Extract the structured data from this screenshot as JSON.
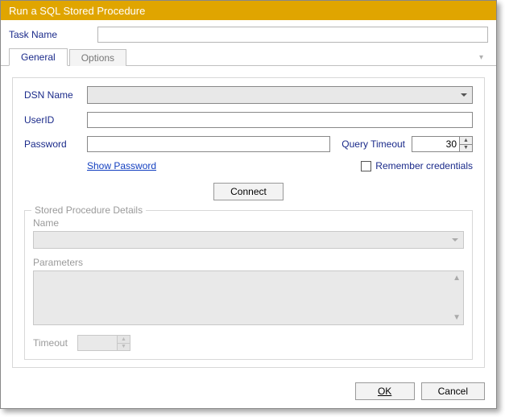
{
  "window": {
    "title": "Run a SQL Stored Procedure"
  },
  "taskname": {
    "label": "Task Name",
    "value": ""
  },
  "tabs": {
    "general": "General",
    "options": "Options"
  },
  "form": {
    "dsn_label": "DSN Name",
    "dsn_value": "",
    "userid_label": "UserID",
    "userid_value": "",
    "password_label": "Password",
    "password_value": "",
    "query_timeout_label": "Query Timeout",
    "query_timeout_value": "30",
    "show_password": "Show Password",
    "remember_credentials": "Remember credentials",
    "connect": "Connect"
  },
  "sp": {
    "legend": "Stored Procedure Details",
    "name_label": "Name",
    "name_value": "",
    "params_label": "Parameters",
    "timeout_label": "Timeout",
    "timeout_value": ""
  },
  "footer": {
    "ok": "OK",
    "cancel": "Cancel"
  }
}
